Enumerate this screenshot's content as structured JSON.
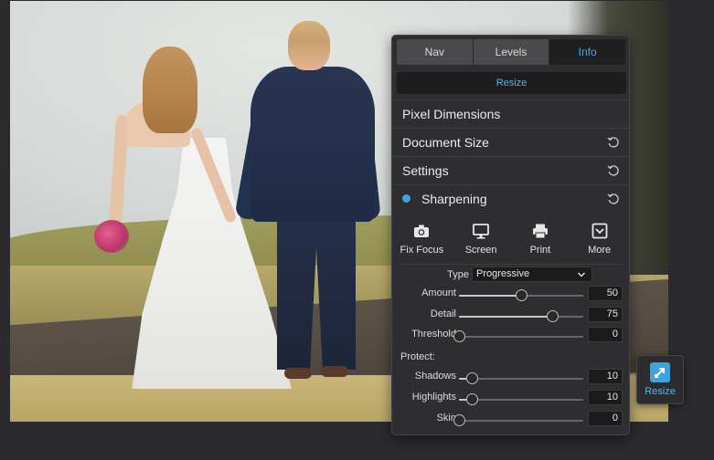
{
  "tabs": [
    {
      "label": "Nav",
      "active": false
    },
    {
      "label": "Levels",
      "active": false
    },
    {
      "label": "Info",
      "active": true
    }
  ],
  "resize_button": "Resize",
  "sections": {
    "pixel_dimensions": "Pixel Dimensions",
    "document_size": "Document Size",
    "settings": "Settings",
    "sharpening": "Sharpening"
  },
  "tools": [
    {
      "label": "Fix Focus",
      "icon": "camera-icon"
    },
    {
      "label": "Screen",
      "icon": "monitor-icon"
    },
    {
      "label": "Print",
      "icon": "printer-icon"
    },
    {
      "label": "More",
      "icon": "dropdown-box-icon"
    }
  ],
  "type": {
    "label": "Type",
    "value": "Progressive"
  },
  "sharpening_sliders": [
    {
      "label": "Amount",
      "value": "50",
      "level": 0.5
    },
    {
      "label": "Detail",
      "value": "75",
      "level": 0.75
    },
    {
      "label": "Threshold",
      "value": "0",
      "level": 0.0
    }
  ],
  "protect_label": "Protect:",
  "protect_sliders": [
    {
      "label": "Shadows",
      "value": "10",
      "level": 0.1
    },
    {
      "label": "Highlights",
      "value": "10",
      "level": 0.1
    },
    {
      "label": "Skin",
      "value": "0",
      "level": 0.0
    }
  ],
  "fab": {
    "label": "Resize"
  },
  "colors": {
    "accent": "#3ea3e0",
    "panel": "#2e2e30",
    "background": "#2b2b2d"
  }
}
